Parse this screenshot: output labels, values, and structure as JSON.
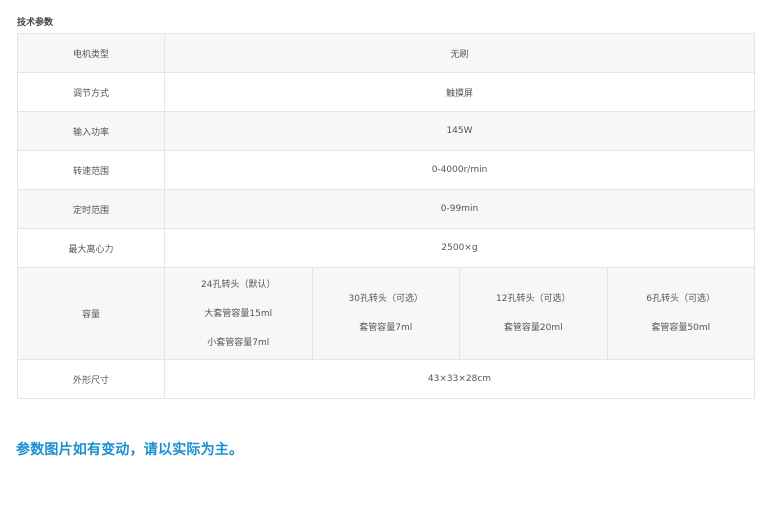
{
  "section_title": "技术参数",
  "rows": [
    {
      "label": "电机类型",
      "value": "无刷"
    },
    {
      "label": "调节方式",
      "value": "触摸屏"
    },
    {
      "label": "输入功率",
      "value": "145W"
    },
    {
      "label": "转速范围",
      "value": "0-4000r/min"
    },
    {
      "label": "定时范围",
      "value": "0-99min"
    },
    {
      "label": "最大离心力",
      "value": "2500×g"
    }
  ],
  "capacity": {
    "label": "容量",
    "rotors": [
      {
        "lines": [
          "24孔转头（默认）",
          "大套管容量15ml",
          "小套管容量7ml"
        ]
      },
      {
        "lines": [
          "30孔转头（可选）",
          "套管容量7ml"
        ]
      },
      {
        "lines": [
          "12孔转头（可选）",
          "套管容量20ml"
        ]
      },
      {
        "lines": [
          "6孔转头（可选）",
          "套管容量50ml"
        ]
      }
    ]
  },
  "size": {
    "label": "外形尺寸",
    "value": "43×33×28cm"
  },
  "note": "参数图片如有变动，请以实际为主。"
}
